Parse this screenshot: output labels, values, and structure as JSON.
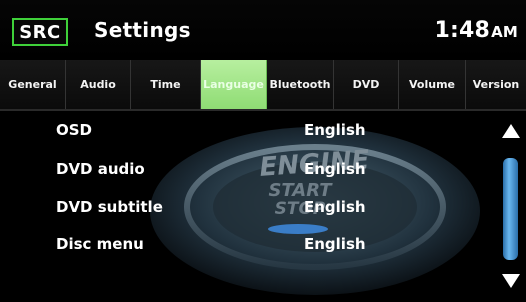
{
  "header": {
    "source_button": "SRC",
    "title": "Settings",
    "clock": {
      "time": "1:48",
      "period": "AM"
    }
  },
  "tabs": [
    {
      "label": "General",
      "active": false
    },
    {
      "label": "Audio",
      "active": false
    },
    {
      "label": "Time",
      "active": false
    },
    {
      "label": "Language",
      "active": true
    },
    {
      "label": "Bluetooth",
      "active": false
    },
    {
      "label": "DVD",
      "active": false
    },
    {
      "label": "Volume",
      "active": false
    },
    {
      "label": "Version",
      "active": false
    }
  ],
  "settings": [
    {
      "label": "OSD",
      "value": "English"
    },
    {
      "label": "DVD audio",
      "value": "English"
    },
    {
      "label": "DVD subtitle",
      "value": "English"
    },
    {
      "label": "Disc menu",
      "value": "English"
    }
  ],
  "background": {
    "line1": "ENGINE",
    "line2": "START",
    "line3": "STOP"
  },
  "colors": {
    "accent_green": "#3fd13a",
    "active_tab": "#9fe283",
    "scroll_blue": "#4f9ad8"
  },
  "icons": {
    "scroll_up": "triangle-up-icon",
    "scroll_down": "triangle-down-icon"
  }
}
